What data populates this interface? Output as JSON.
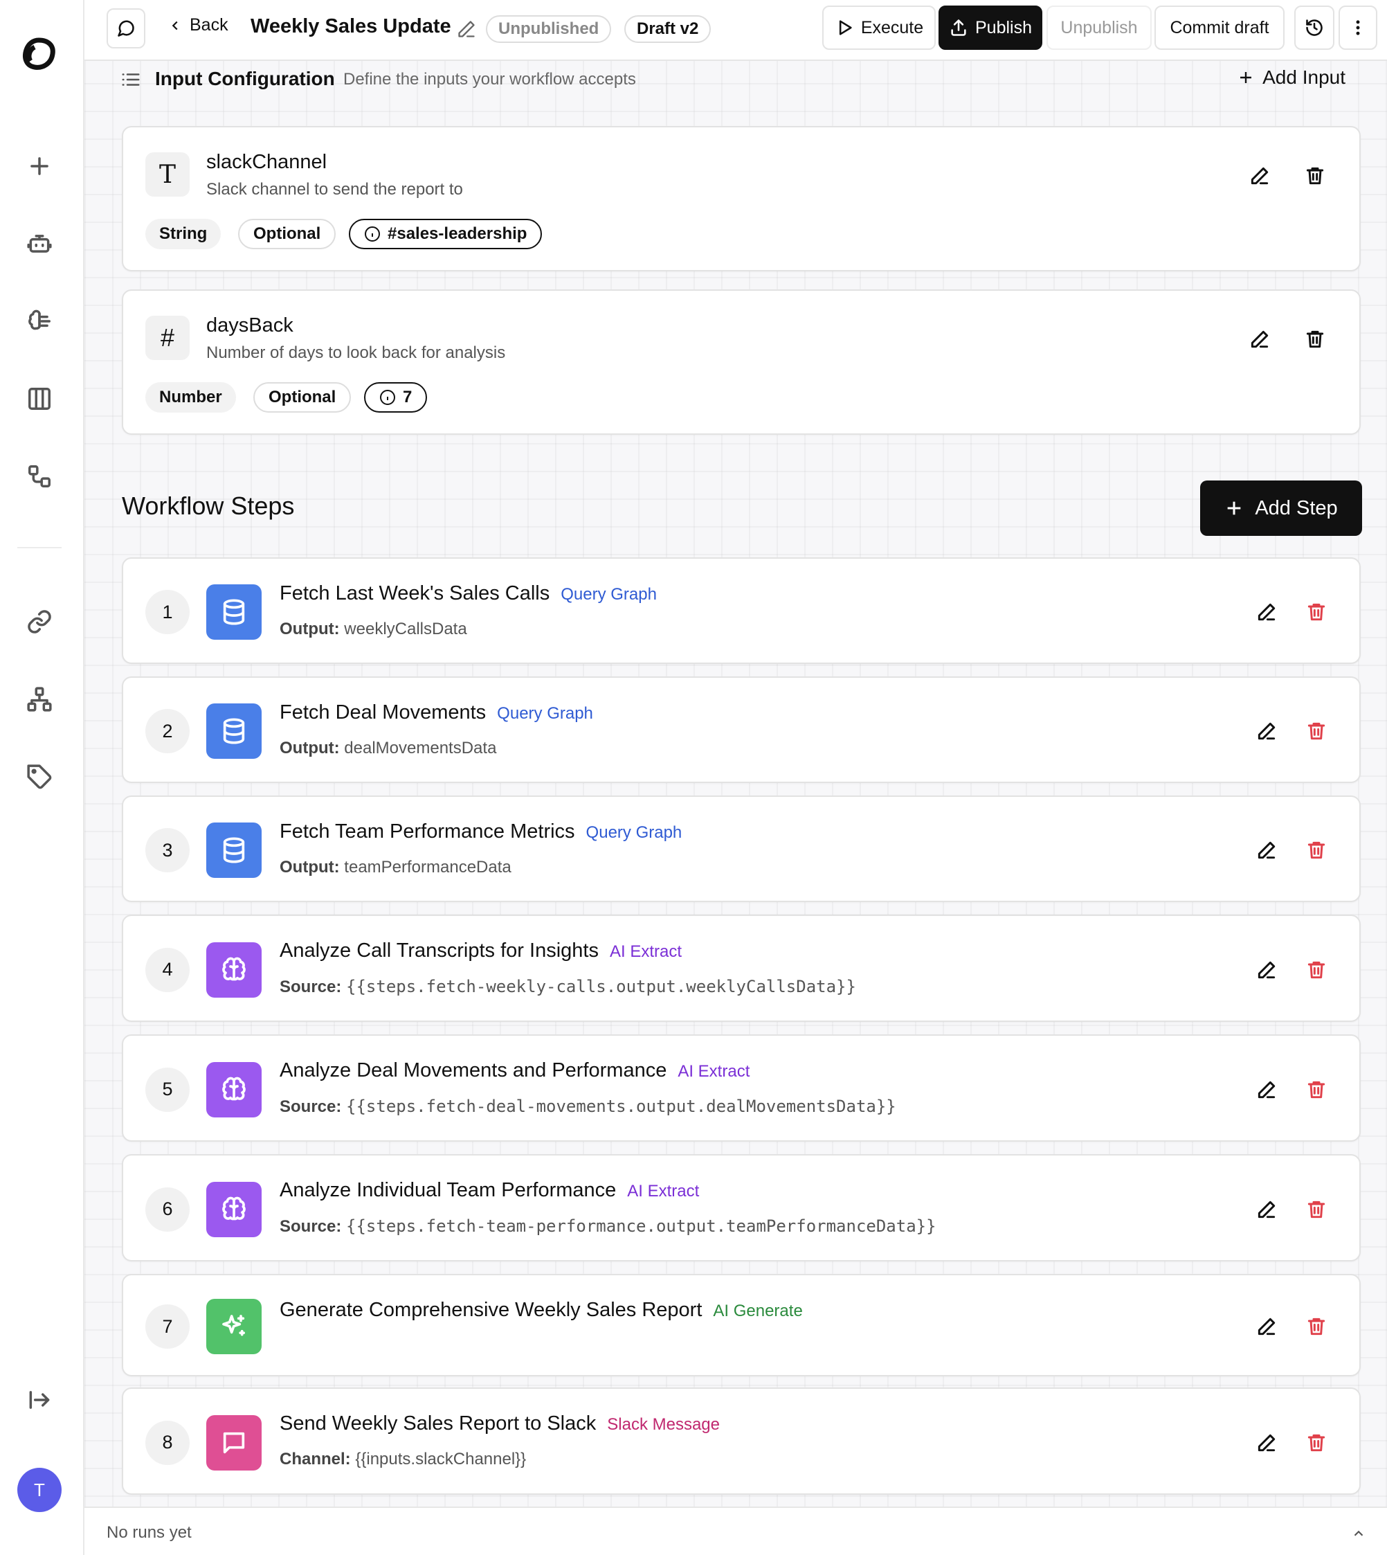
{
  "sidebar": {
    "avatar_initial": "T"
  },
  "topbar": {
    "back_label": "Back",
    "workflow_title": "Weekly Sales Update",
    "status_badge": "Unpublished",
    "draft_badge": "Draft v2",
    "execute_label": "Execute",
    "publish_label": "Publish",
    "unpublish_label": "Unpublish",
    "commit_label": "Commit draft"
  },
  "input_config": {
    "title": "Input Configuration",
    "subtitle": "Define the inputs your workflow accepts",
    "add_label": "Add Input",
    "inputs": [
      {
        "type_glyph": "T",
        "name": "slackChannel",
        "description": "Slack channel to send the report to",
        "type": "String",
        "required": "Optional",
        "default": "#sales-leadership"
      },
      {
        "type_glyph": "#",
        "name": "daysBack",
        "description": "Number of days to look back for analysis",
        "type": "Number",
        "required": "Optional",
        "default": "7"
      }
    ]
  },
  "workflow_steps": {
    "title": "Workflow Steps",
    "add_label": "Add Step",
    "steps": [
      {
        "num": "1",
        "title": "Fetch Last Week's Sales Calls",
        "type": "Query Graph",
        "sub_label": "Output:",
        "sub_value": "weeklyCallsData"
      },
      {
        "num": "2",
        "title": "Fetch Deal Movements",
        "type": "Query Graph",
        "sub_label": "Output:",
        "sub_value": "dealMovementsData"
      },
      {
        "num": "3",
        "title": "Fetch Team Performance Metrics",
        "type": "Query Graph",
        "sub_label": "Output:",
        "sub_value": "teamPerformanceData"
      },
      {
        "num": "4",
        "title": "Analyze Call Transcripts for Insights",
        "type": "AI Extract",
        "sub_label": "Source:",
        "sub_value": "{{steps.fetch-weekly-calls.output.weeklyCallsData}}"
      },
      {
        "num": "5",
        "title": "Analyze Deal Movements and Performance",
        "type": "AI Extract",
        "sub_label": "Source:",
        "sub_value": "{{steps.fetch-deal-movements.output.dealMovementsData}}"
      },
      {
        "num": "6",
        "title": "Analyze Individual Team Performance",
        "type": "AI Extract",
        "sub_label": "Source:",
        "sub_value": "{{steps.fetch-team-performance.output.teamPerformanceData}}"
      },
      {
        "num": "7",
        "title": "Generate Comprehensive Weekly Sales Report",
        "type": "AI Generate"
      },
      {
        "num": "8",
        "title": "Send Weekly Sales Report to Slack",
        "type": "Slack Message",
        "sub_label": "Channel:",
        "sub_value": "{{inputs.slackChannel}}"
      }
    ]
  },
  "footer": {
    "status_text": "No runs yet"
  },
  "colors": {
    "query_graph": "#4a7fe8",
    "ai_extract": "#9b59ef",
    "ai_generate": "#52c26a",
    "slack_message": "#df4f94",
    "query_graph_text": "#2f5bd3",
    "ai_extract_text": "#7b2fd6",
    "ai_generate_text": "#2a8a3c",
    "slack_message_text": "#c0286f",
    "delete_red": "#e0404a"
  }
}
